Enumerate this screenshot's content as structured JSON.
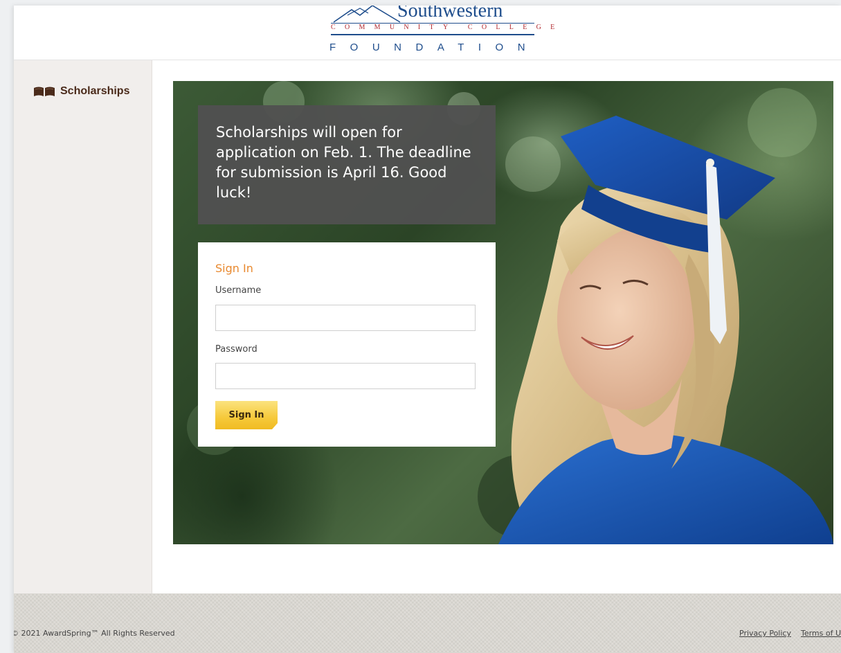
{
  "brand": {
    "name": "Southwestern",
    "subtitle": "COMMUNITY COLLEGE",
    "foundation": "FOUNDATION",
    "colors": {
      "blue": "#1e4d8c",
      "red": "#b0282e"
    }
  },
  "sidebar": {
    "items": [
      {
        "label": "Scholarships",
        "icon": "open-book-icon"
      }
    ]
  },
  "announcement": {
    "text": "Scholarships will open for application on Feb. 1. The deadline for submission is April 16. Good luck!"
  },
  "signin": {
    "title": "Sign In",
    "username_label": "Username",
    "username_value": "",
    "password_label": "Password",
    "password_value": "",
    "button_label": "Sign In",
    "accent_color": "#e8892f",
    "button_color": "#f6c93a"
  },
  "footer": {
    "copyright": "© 2021 AwardSpring™ All Rights Reserved",
    "links": [
      "Privacy Policy",
      "Terms of Use"
    ]
  }
}
